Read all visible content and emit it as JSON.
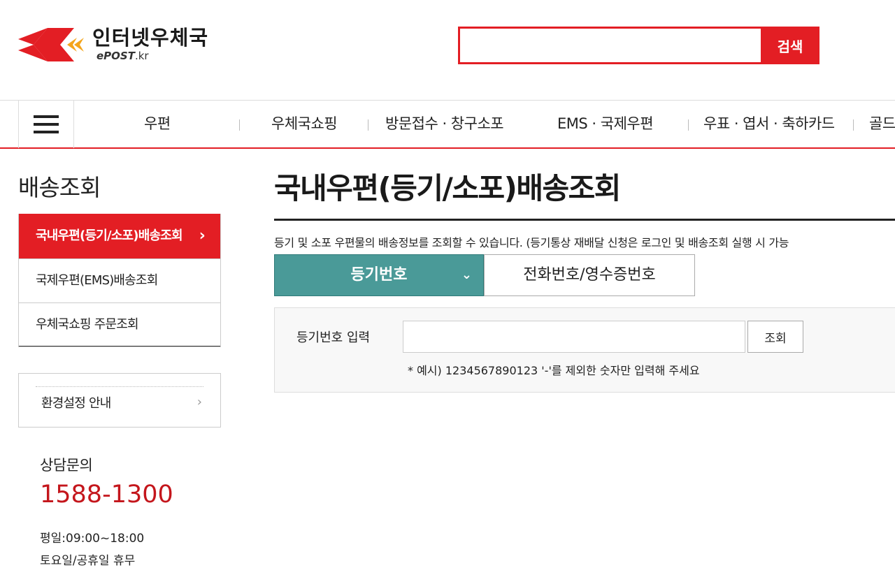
{
  "header": {
    "logo_title": "인터넷우체국",
    "logo_sub_brand": "ePOST",
    "logo_sub_tld": ".kr",
    "search_placeholder": "",
    "search_button": "검색"
  },
  "nav": {
    "items": [
      "우편",
      "우체국쇼핑",
      "방문접수 · 창구소포",
      "EMS · 국제우편",
      "우표 · 엽서 · 축하카드",
      "골드"
    ]
  },
  "sidebar": {
    "title": "배송조회",
    "items": [
      {
        "label": "국내우편(등기/소포)배송조회",
        "active": true
      },
      {
        "label": "국제우편(EMS)배송조회",
        "active": false
      },
      {
        "label": "우체국쇼핑 주문조회",
        "active": false
      }
    ],
    "active_chevron": "›",
    "env_label": "환경설정 안내",
    "env_chevron": "›",
    "consult_title": "상담문의",
    "consult_phone": "1588-1300",
    "consult_hours": "평일:09:00~18:00",
    "consult_holiday": "토요일/공휴일 휴무"
  },
  "main": {
    "title": "국내우편(등기/소포)배송조회",
    "description": "등기 및 소포 우편물의 배송정보를 조회할 수 있습니다. (등기통상 재배달 신청은 로그인 및 배송조회 실행 시 가능",
    "tabs": [
      {
        "label": "등기번호",
        "active": true
      },
      {
        "label": "전화번호/영수증번호",
        "active": false
      }
    ],
    "tab_chevron": "⌄",
    "form": {
      "label": "등기번호 입력",
      "input_value": "",
      "button": "조회",
      "hint": "* 예시) 1234567890123 '-'를 제외한 숫자만 입력해 주세요"
    }
  },
  "colors": {
    "brand_red": "#e31e24",
    "tab_teal": "#4a9a98",
    "phone_red": "#c4161c"
  }
}
